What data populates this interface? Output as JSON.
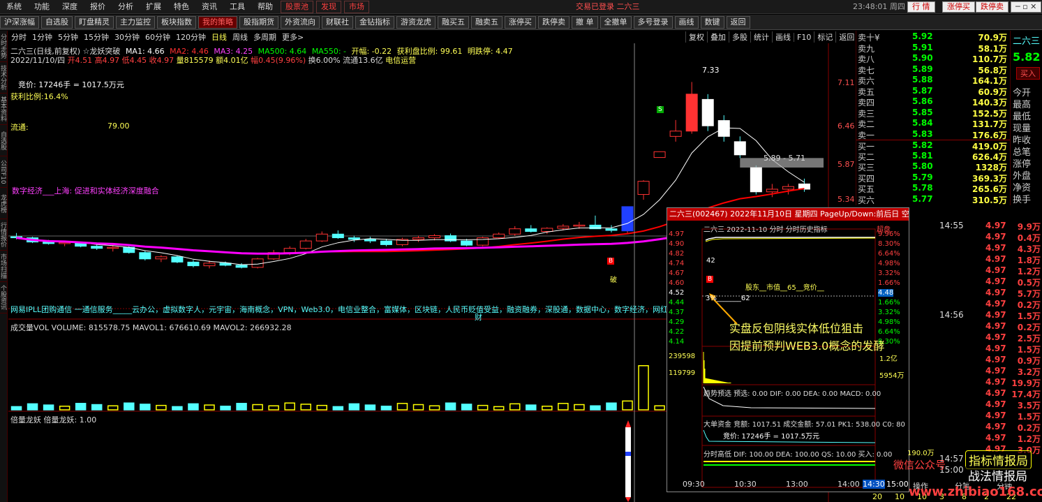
{
  "menu": {
    "items": [
      "系统",
      "功能",
      "深度",
      "报价",
      "分析",
      "扩展",
      "特色",
      "资讯",
      "工具",
      "帮助"
    ],
    "red_items": [
      "股票池",
      "发现",
      "市场"
    ],
    "status": "交易已登录   二六三",
    "clock": "23:48:01 周四",
    "buttons": [
      "行  情",
      "涨停买",
      "跌停卖"
    ]
  },
  "toolbar": {
    "items": [
      "沪深涨幅",
      "自选股",
      "盯盘精灵",
      "主力监控",
      "板块指数",
      "我的策略",
      "股指期货",
      "外资流向",
      "财联社",
      "金钻指标",
      "游资龙虎",
      "融买五",
      "融卖五",
      "涨停买",
      "跌停卖",
      "撤 单",
      "全撤单",
      "多号登录",
      "画线",
      "数键",
      "返回"
    ],
    "active_index": 5
  },
  "periods": {
    "items": [
      "分时",
      "1分钟",
      "5分钟",
      "15分钟",
      "30分钟",
      "60分钟",
      "120分钟",
      "日线",
      "周线",
      "多周期",
      "更多>"
    ],
    "active_index": 7
  },
  "right_tools": [
    "复权",
    "叠加",
    "多股",
    "统计",
    "画线",
    "F10",
    "标记",
    "返回"
  ],
  "left_tabs": [
    "分时走势",
    "技术分析",
    "基本资料",
    "自选股",
    "公司F10",
    "龙虎榜",
    "行情报价",
    "市场扫描",
    "个股资讯"
  ],
  "chart": {
    "header_line1_a": "二六三(日线,前复权) ☆龙妖突破",
    "ma1": "MA1: 4.66",
    "ma2": "MA2: 4.46",
    "ma3": "MA3: 4.25",
    "ma500": "MA500: 4.64",
    "ma550": "MA550: -",
    "kaifu": "开幅: -0.22",
    "profit_ratio": "获利盘比例: 99.61",
    "mingdieting": "明跌停: 4.47",
    "header_line2_date": "2022/11/10/四",
    "open": "开4.51",
    "high": "高4.97",
    "low": "低4.45",
    "close": "收4.97",
    "volume": "量815579",
    "amount": "额4.01亿",
    "change": "幅0.45(9.96%)",
    "turnover": "换6.00%",
    "float_cap": "流通13.6亿",
    "sector": "电信运营",
    "bid_text": "竞价: 17246手 = 1017.5万元",
    "profit_pct": "获利比例:16.4%",
    "float_label": "流通:",
    "float_val": "79.00",
    "news": "数字经济___上海: 促进和实体经济深度融合",
    "concepts": "网易IPLL团购通信 一通信服务_____云办公，虚拟数字人，元宇宙，海南概念，VPN，Web3.0，电信业整合，富媒体，区块链，人民币贬值受益，融资融券，深股通，数据中心，数字经济，网红经济，",
    "price_axis": [
      "7.11",
      "6.46",
      "5.87",
      "5.34"
    ],
    "peak_label": "7.33",
    "gap_label": "5.89 - 5.71",
    "vol_header": "成交量VOL VOLUME: 815578.75 MAVOL1: 676610.69 MAVOL2: 266932.28",
    "ind_header": "倍量龙妖 倍量龙妖: 1.00",
    "marker_b": "B",
    "marker_s": "S",
    "marker_cai": "财",
    "marker_po": "破"
  },
  "orderbook": {
    "rows": [
      {
        "label": "卖十¥",
        "price": "5.92",
        "vol": "70.9万",
        "side": "sell"
      },
      {
        "label": "卖九",
        "price": "5.91",
        "vol": "58.1万",
        "side": "sell"
      },
      {
        "label": "卖八",
        "price": "5.90",
        "vol": "110.7万",
        "side": "sell"
      },
      {
        "label": "卖七",
        "price": "5.89",
        "vol": "56.8万",
        "side": "sell"
      },
      {
        "label": "卖六",
        "price": "5.88",
        "vol": "164.1万",
        "side": "sell"
      },
      {
        "label": "卖五",
        "price": "5.87",
        "vol": "60.9万",
        "side": "sell"
      },
      {
        "label": "卖四",
        "price": "5.86",
        "vol": "140.3万",
        "side": "sell"
      },
      {
        "label": "卖三",
        "price": "5.85",
        "vol": "152.5万",
        "side": "sell"
      },
      {
        "label": "卖二",
        "price": "5.84",
        "vol": "131.7万",
        "side": "sell"
      },
      {
        "label": "卖一",
        "price": "5.83",
        "vol": "176.6万",
        "side": "sell"
      },
      {
        "label": "买一",
        "price": "5.82",
        "vol": "419.0万",
        "side": "buy"
      },
      {
        "label": "买二",
        "price": "5.81",
        "vol": "626.4万",
        "side": "buy"
      },
      {
        "label": "买三",
        "price": "5.80",
        "vol": "1328万",
        "side": "buy"
      },
      {
        "label": "买四",
        "price": "5.79",
        "vol": "369.3万",
        "side": "buy"
      },
      {
        "label": "买五",
        "price": "5.78",
        "vol": "265.6万",
        "side": "buy"
      },
      {
        "label": "买六",
        "price": "5.77",
        "vol": "310.5万",
        "side": "buy"
      }
    ]
  },
  "farright": {
    "name": "二六三",
    "price": "5.82",
    "buy_btn": "买入",
    "labels": [
      "今开",
      "最高",
      "最低",
      "现量",
      "昨收",
      "总笔",
      "涨停",
      "外盘",
      "净资",
      "换手"
    ]
  },
  "ticks": [
    {
      "time": "14:55",
      "price": "4.97",
      "vol": "9.9万"
    },
    {
      "time": "",
      "price": "4.97",
      "vol": "0.4万"
    },
    {
      "time": "",
      "price": "4.97",
      "vol": "4.3万"
    },
    {
      "time": "",
      "price": "4.97",
      "vol": "1.8万"
    },
    {
      "time": "",
      "price": "4.97",
      "vol": "1.2万"
    },
    {
      "time": "",
      "price": "4.97",
      "vol": "0.5万"
    },
    {
      "time": "",
      "price": "4.97",
      "vol": "5.7万"
    },
    {
      "time": "",
      "price": "4.97",
      "vol": "0.2万"
    },
    {
      "time": "14:56",
      "price": "4.97",
      "vol": "1.5万"
    },
    {
      "time": "",
      "price": "4.97",
      "vol": "0.2万"
    },
    {
      "time": "",
      "price": "4.97",
      "vol": "2.5万"
    },
    {
      "time": "",
      "price": "4.97",
      "vol": "1.5万"
    },
    {
      "time": "",
      "price": "4.97",
      "vol": "0.9万"
    },
    {
      "time": "",
      "price": "4.97",
      "vol": "3.2万"
    },
    {
      "time": "",
      "price": "4.97",
      "vol": "19.9万"
    },
    {
      "time": "",
      "price": "4.97",
      "vol": "17.4万"
    },
    {
      "time": "",
      "price": "4.97",
      "vol": "3.5万"
    },
    {
      "time": "",
      "price": "4.97",
      "vol": "1.5万"
    },
    {
      "time": "",
      "price": "4.97",
      "vol": "0.2万"
    },
    {
      "time": "",
      "price": "4.97",
      "vol": "1.2万"
    },
    {
      "time": "",
      "price": "4.97",
      "vol": "3.0万"
    }
  ],
  "popup": {
    "title": "二六三(002467) 2022年11月10日 星期四 PageUp/Down:前后日 空格键:操作",
    "inner_title": "二六三  2022-11-10 分时 分时历史指标",
    "superdisk": "超盘",
    "left_axis": [
      "4.97",
      "4.90",
      "4.82",
      "4.74",
      "4.67",
      "4.60",
      "4.52",
      "4.44",
      "4.37",
      "4.29",
      "4.22",
      "4.14"
    ],
    "right_axis": [
      "9.96%",
      "8.30%",
      "6.64%",
      "4.98%",
      "3.32%",
      "1.66%",
      "4.48",
      "1.66%",
      "3.32%",
      "4.98%",
      "6.64%",
      "8.30%"
    ],
    "vol_axis": [
      "239598",
      "119799"
    ],
    "vol_right": [
      "1.2亿",
      "5954万"
    ],
    "shareholder_note": "股东__市值__65__竞价__",
    "pct_note": "3%_______62",
    "trend_header": "趋势预选  预选: 0.00 DIF: 0.00 DEA: 0.00 MACD: 0.00",
    "bigfund_header": "大单资金  竞额: 1017.51  成交金额: 57.01  PK1: 538.00  C0: 80",
    "bid_line": "竞价: 17246手 = 1017.5万元",
    "hilow_header": "分时高低  DIF: 100.00  DEA: 100.00  QS: 10.00  买入: 0.00",
    "time_axis": [
      "09:30",
      "10:30",
      "13:00",
      "14:00"
    ],
    "marker_b": "B",
    "marker_42": "42"
  },
  "bottom_axis": {
    "times": [
      "14:30",
      "15:00"
    ],
    "labels": [
      "操作",
      "分笔",
      "分钟"
    ],
    "side_times": [
      "14:57",
      "15:00"
    ],
    "side_vals": [
      "190.0万"
    ],
    "nums": [
      "20",
      "10",
      "10",
      "3",
      "8",
      "2",
      "22"
    ]
  },
  "annotation": {
    "line1": "实盘反包阴线实体低位狙击",
    "line2": "因提前预判WEB3.0概念的发酵"
  },
  "watermarks": {
    "wechat": "微信公众号",
    "brand1": "指标情报局",
    "brand2": "战法情报局",
    "url": "www.zhibiao168.com"
  },
  "colors": {
    "up": "#ff3232",
    "down": "#54ffff",
    "ma1": "#ffffff",
    "ma2": "#ff0000",
    "ma3": "#ff00ff",
    "yellow": "#ffff00",
    "green": "#00ff00"
  },
  "chart_data": {
    "type": "candlestick",
    "title": "二六三(日线,前复权)",
    "candles": [
      [
        4.4,
        4.47,
        4.35,
        4.38
      ],
      [
        4.38,
        4.4,
        4.28,
        4.3
      ],
      [
        4.3,
        4.34,
        4.25,
        4.27
      ],
      [
        4.27,
        4.32,
        4.22,
        4.29
      ],
      [
        4.29,
        4.3,
        4.2,
        4.22
      ],
      [
        4.22,
        4.26,
        4.15,
        4.18
      ],
      [
        4.18,
        4.24,
        4.12,
        4.2
      ],
      [
        4.2,
        4.22,
        4.08,
        4.1
      ],
      [
        4.1,
        4.14,
        3.95,
        3.98
      ],
      [
        3.98,
        4.05,
        3.92,
        4.02
      ],
      [
        4.02,
        4.04,
        3.9,
        3.92
      ],
      [
        3.92,
        3.96,
        3.82,
        3.85
      ],
      [
        3.85,
        3.95,
        3.8,
        3.9
      ],
      [
        3.9,
        3.93,
        3.84,
        3.86
      ],
      [
        3.86,
        3.9,
        3.8,
        3.82
      ],
      [
        3.82,
        4.0,
        3.8,
        3.98
      ],
      [
        3.98,
        4.15,
        3.96,
        4.1
      ],
      [
        4.1,
        4.22,
        4.05,
        4.18
      ],
      [
        4.18,
        4.36,
        4.16,
        4.32
      ],
      [
        4.32,
        4.5,
        4.3,
        4.45
      ],
      [
        4.45,
        4.52,
        4.36,
        4.38
      ],
      [
        4.38,
        4.42,
        4.3,
        4.35
      ],
      [
        4.35,
        4.4,
        4.28,
        4.32
      ],
      [
        4.32,
        4.36,
        4.22,
        4.25
      ],
      [
        4.25,
        4.38,
        4.22,
        4.35
      ],
      [
        4.35,
        4.42,
        4.3,
        4.38
      ],
      [
        4.38,
        4.45,
        4.33,
        4.42
      ],
      [
        4.42,
        4.46,
        4.3,
        4.32
      ],
      [
        4.32,
        4.36,
        4.22,
        4.24
      ],
      [
        4.24,
        4.4,
        4.22,
        4.38
      ],
      [
        4.38,
        4.48,
        4.36,
        4.45
      ],
      [
        4.45,
        4.6,
        4.42,
        4.55
      ],
      [
        4.55,
        4.62,
        4.48,
        4.5
      ],
      [
        4.5,
        4.58,
        4.45,
        4.56
      ],
      [
        4.56,
        4.64,
        4.52,
        4.6
      ],
      [
        4.6,
        4.68,
        4.55,
        4.62
      ],
      [
        4.62,
        4.8,
        4.58,
        4.55
      ],
      [
        4.55,
        4.62,
        4.48,
        4.52
      ],
      [
        4.51,
        4.97,
        4.45,
        4.97
      ],
      [
        5.2,
        5.47,
        5.1,
        5.45
      ],
      [
        5.9,
        6.01,
        5.9,
        6.01
      ],
      [
        6.3,
        6.61,
        6.2,
        6.4
      ],
      [
        6.4,
        7.33,
        6.35,
        7.1
      ],
      [
        7.0,
        7.1,
        6.4,
        6.5
      ],
      [
        6.6,
        6.7,
        6.2,
        6.3
      ],
      [
        6.2,
        6.3,
        5.89,
        5.95
      ],
      [
        5.71,
        5.75,
        5.2,
        5.25
      ],
      [
        5.25,
        5.4,
        5.15,
        5.3
      ],
      [
        5.3,
        5.4,
        5.2,
        5.35
      ],
      [
        5.4,
        5.5,
        5.25,
        5.3
      ]
    ],
    "ylim": [
      3.7,
      7.6
    ]
  }
}
